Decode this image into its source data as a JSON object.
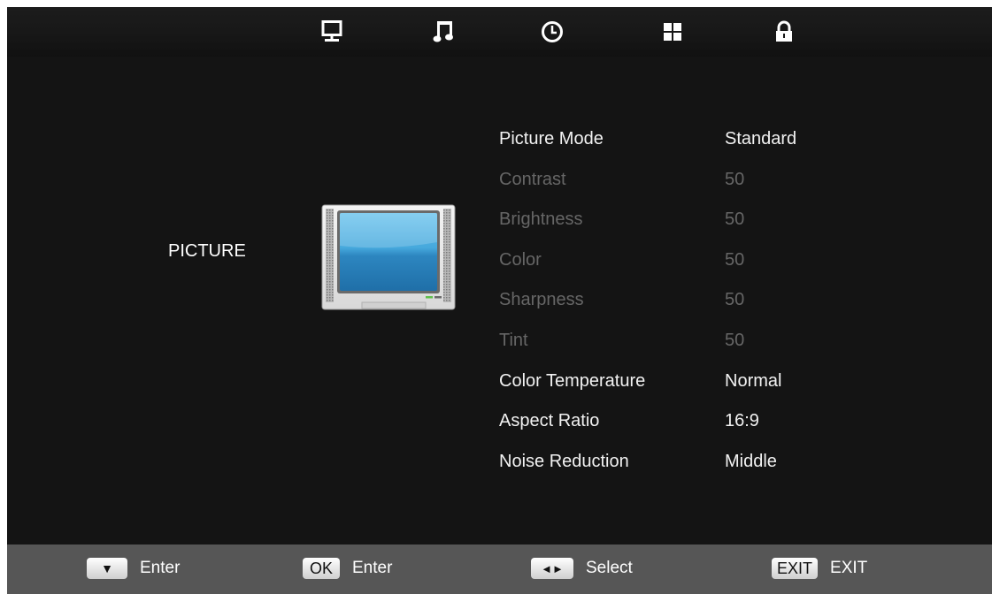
{
  "tabs": [
    {
      "name": "picture-tab-icon",
      "icon": "monitor-icon",
      "active": true
    },
    {
      "name": "sound-tab-icon",
      "icon": "music-note-icon",
      "active": false
    },
    {
      "name": "time-tab-icon",
      "icon": "clock-icon",
      "active": false
    },
    {
      "name": "setup-tab-icon",
      "icon": "grid-icon",
      "active": false
    },
    {
      "name": "lock-tab-icon",
      "icon": "padlock-icon",
      "active": false
    }
  ],
  "section": {
    "title": "PICTURE",
    "illustration": "tv-set-icon"
  },
  "menu": [
    {
      "label": "Picture Mode",
      "value": "Standard",
      "enabled": true
    },
    {
      "label": "Contrast",
      "value": "50",
      "enabled": false
    },
    {
      "label": "Brightness",
      "value": "50",
      "enabled": false
    },
    {
      "label": "Color",
      "value": "50",
      "enabled": false
    },
    {
      "label": "Sharpness",
      "value": "50",
      "enabled": false
    },
    {
      "label": "Tint",
      "value": "50",
      "enabled": false
    },
    {
      "label": "Color Temperature",
      "value": "Normal",
      "enabled": true
    },
    {
      "label": "Aspect Ratio",
      "value": "16:9",
      "enabled": true
    },
    {
      "label": "Noise Reduction",
      "value": "Middle",
      "enabled": true
    }
  ],
  "footer": [
    {
      "key": "▼",
      "label": "Enter"
    },
    {
      "key": "OK",
      "label": "Enter"
    },
    {
      "key": "◄►",
      "label": "Select"
    },
    {
      "key": "EXIT",
      "label": "EXIT"
    }
  ],
  "colors": {
    "background": "#141414",
    "footer": "#565656",
    "text_enabled": "#f2f2f2",
    "text_disabled": "#666666",
    "screen_blue": "#3a9fd6"
  }
}
